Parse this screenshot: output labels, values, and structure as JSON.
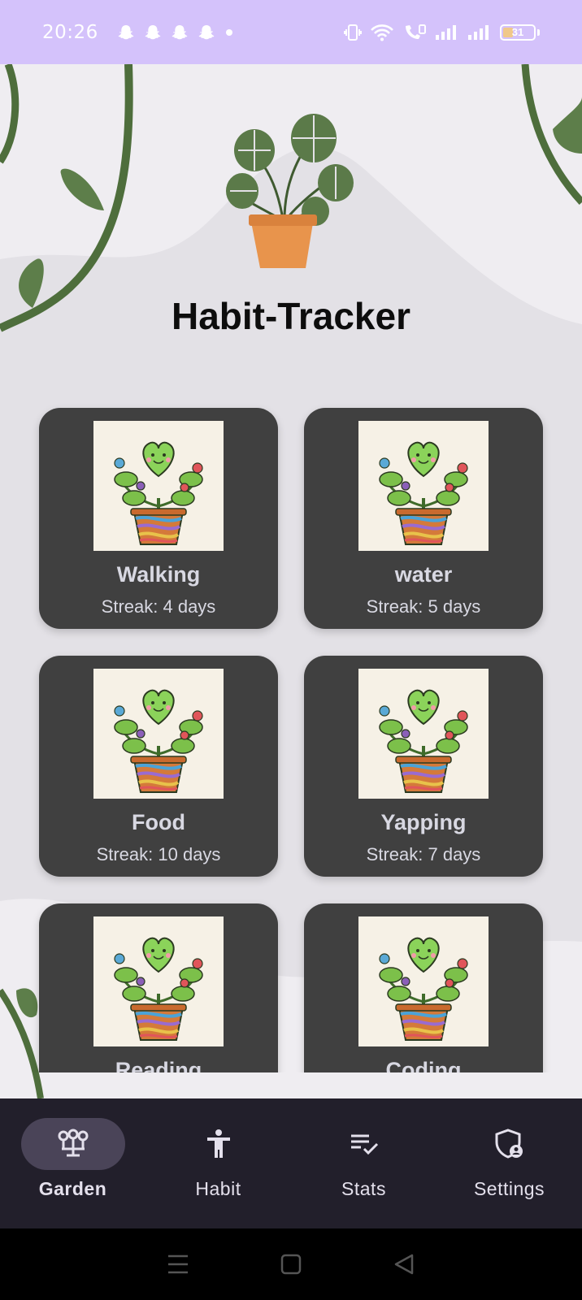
{
  "status_bar": {
    "time": "20:26",
    "notification_icons": [
      "snapchat-icon",
      "snapchat-icon",
      "snapchat-icon",
      "snapchat-icon",
      "dot-icon"
    ],
    "right_icons": [
      "vibrate-icon",
      "wifi-icon",
      "call-wifi-icon",
      "signal-icon",
      "signal-icon"
    ],
    "battery_level": "31",
    "battery_fraction": 0.31
  },
  "header": {
    "title": "Habit-Tracker",
    "logo_icon": "potted-monstera-icon"
  },
  "habits": [
    {
      "name": "Walking",
      "streak": "Streak: 4 days",
      "icon": "heart-plant-icon"
    },
    {
      "name": "water",
      "streak": "Streak: 5 days",
      "icon": "heart-plant-icon"
    },
    {
      "name": "Food",
      "streak": "Streak: 10 days",
      "icon": "heart-plant-icon"
    },
    {
      "name": "Yapping",
      "streak": "Streak: 7 days",
      "icon": "heart-plant-icon"
    },
    {
      "name": "Reading",
      "streak": "",
      "icon": "heart-plant-icon"
    },
    {
      "name": "Coding",
      "streak": "",
      "icon": "heart-plant-icon"
    }
  ],
  "bottom_nav": {
    "active": "Garden",
    "items": [
      {
        "label": "Garden",
        "icon": "garden-icon"
      },
      {
        "label": "Habit",
        "icon": "person-icon"
      },
      {
        "label": "Stats",
        "icon": "checklist-icon"
      },
      {
        "label": "Settings",
        "icon": "shield-person-icon"
      }
    ]
  },
  "colors": {
    "status_bar": "#d4c2fb",
    "background": "#efedf1",
    "card": "#404040",
    "nav_bar": "#221f2b",
    "nav_active_pill": "#4a4458",
    "leaf_green": "#4e6e3c"
  }
}
